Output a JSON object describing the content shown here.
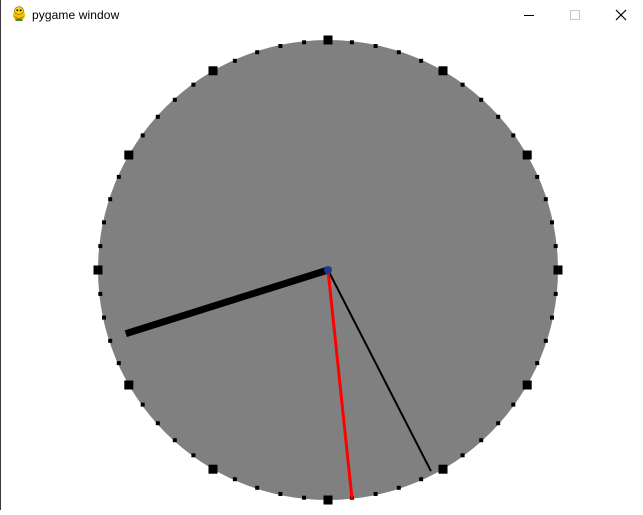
{
  "window": {
    "title": "pygame window",
    "icon": "pygame-snake-icon",
    "controls": [
      "minimize-icon",
      "maximize-icon",
      "close-icon"
    ]
  },
  "clock": {
    "face_color": "#808080",
    "marker_color": "#000000",
    "hour_hand_color": "#000000",
    "minute_hand_color": "#000000",
    "second_hand_color": "#ff0000",
    "center_color": "#1f3a8a",
    "hour_markers": 12,
    "minute_markers": 60,
    "time": {
      "hours": 8,
      "minutes": 25,
      "seconds": 29
    }
  }
}
